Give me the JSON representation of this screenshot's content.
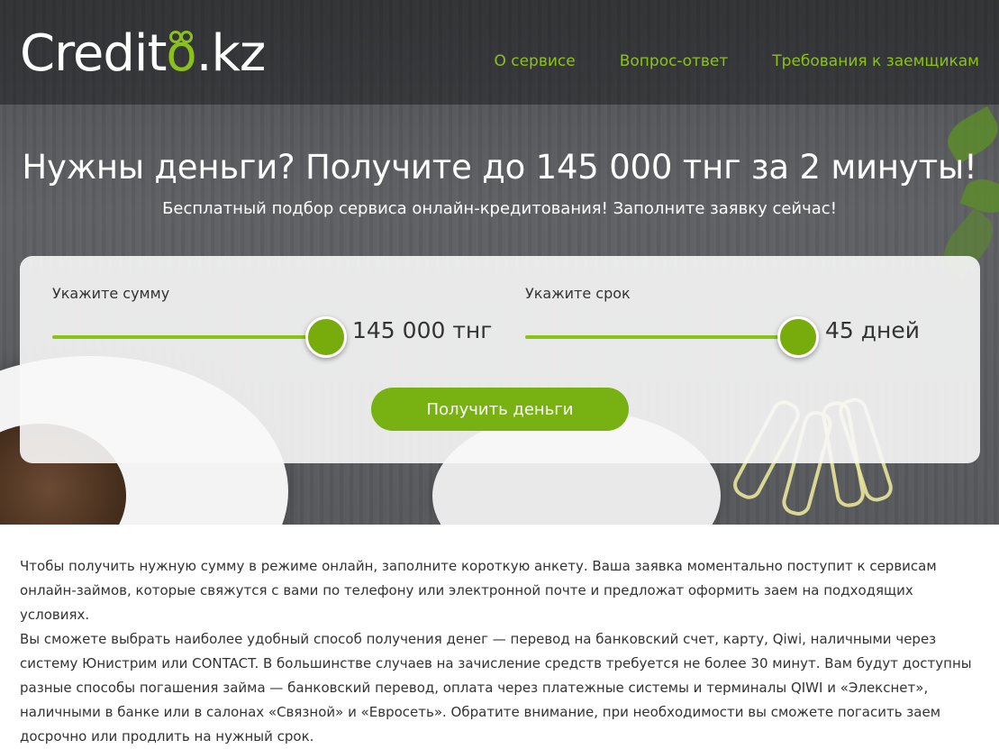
{
  "header": {
    "logo_text_start": "Credit",
    "logo_text_accent": "o",
    "logo_text_end": ".kz",
    "nav": [
      {
        "label": "О сервисе"
      },
      {
        "label": "Вопрос-ответ"
      },
      {
        "label": "Требования к заемщикам"
      }
    ]
  },
  "hero": {
    "title": "Нужны деньги? Получите до 145 000 тнг за 2 минуты!",
    "subtitle": "Бесплатный подбор сервиса онлайн-кредитования! Заполните заявку сейчас!"
  },
  "form": {
    "amount": {
      "label": "Укажите сумму",
      "value_text": "145 000 тнг",
      "level": 1.0
    },
    "term": {
      "label": "Укажите срок",
      "value_text": "45 дней",
      "level": 1.0
    },
    "submit_label": "Получить деньги"
  },
  "content": {
    "paragraph_1": "Чтобы получить нужную сумму в режиме онлайн, заполните короткую анкету. Ваша заявка моментально поступит к сервисам онлайн-займов, которые свяжутся с вами по телефону или электронной почте и предложат оформить заем на подходящих условиях.",
    "paragraph_2": "Вы сможете выбрать наиболее удобный способ получения денег — перевод на банковский счет, карту, Qiwi, наличными через систему Юнистрим или CONTACT. В большинстве случаев на зачисление средств требуется не более 30 минут. Вам будут доступны разные способы погашения займа — банковский перевод, оплата через платежные системы и терминалы QIWI и «Элекснет», наличными в банке или в салонах «Связной» и «Евросеть». Обратите внимание, при необходимости вы сможете погасить заем досрочно или продлить на нужный срок."
  },
  "colors": {
    "accent": "#8bc21a",
    "button": "#78b212",
    "thumb": "#78ac0c"
  }
}
